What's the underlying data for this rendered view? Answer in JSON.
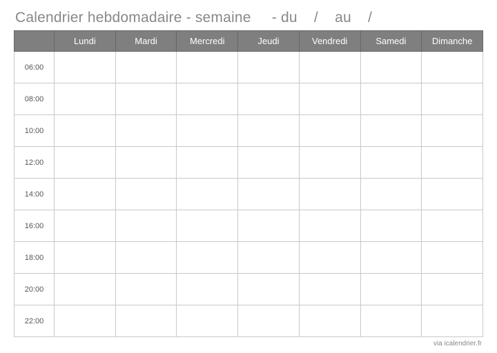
{
  "title": "Calendrier hebdomadaire - semaine     - du    /    au    /",
  "days": [
    "Lundi",
    "Mardi",
    "Mercredi",
    "Jeudi",
    "Vendredi",
    "Samedi",
    "Dimanche"
  ],
  "times": [
    "06:00",
    "08:00",
    "10:00",
    "12:00",
    "14:00",
    "16:00",
    "18:00",
    "20:00",
    "22:00"
  ],
  "footer": "via icalendrier.fr"
}
